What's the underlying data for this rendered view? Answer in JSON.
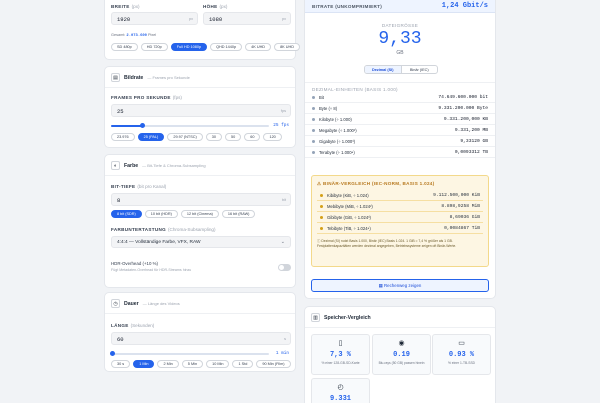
{
  "resolution": {
    "width_label": "BREITE",
    "width_unit": "(px)",
    "width_value": "1920",
    "width_suffix": "px",
    "height_label": "HÖHE",
    "height_unit": "(px)",
    "height_value": "1080",
    "height_suffix": "px",
    "total_prefix": "Gesamt:",
    "total_value": "2.073.600",
    "total_suffix": "Pixel",
    "presets": [
      "SD 480p",
      "HD 720p",
      "Full HD 1080p",
      "QHD 1440p",
      "4K UHD",
      "8K UHD"
    ],
    "active_preset": "Full HD 1080p"
  },
  "framerate": {
    "title": "Bildrate",
    "subtitle": "— Frames pro Sekunde",
    "label": "FRAMES PRO SEKUNDE",
    "unit": "(fps)",
    "value": "25",
    "suffix": "fps",
    "slider_readout": "25 fps",
    "slider_fraction": 0.2,
    "presets": [
      "23.976",
      "25 (PAL)",
      "29.97 (NTSC)",
      "30",
      "50",
      "60",
      "120"
    ],
    "active_preset": "25 (PAL)"
  },
  "color": {
    "title": "Farbe",
    "subtitle": "— Bit-Tiefe & Chroma-Subsampling",
    "bitdepth_label": "BIT-TIEFE",
    "bitdepth_unit": "(bit pro Kanal)",
    "bitdepth_value": "8",
    "bitdepth_suffix": "bit",
    "bitdepth_presets": [
      "8 bit (SDR)",
      "10 bit (HDR)",
      "12 bit (Cinema)",
      "16 bit (RAW)"
    ],
    "active_bitdepth": "8 bit (SDR)",
    "chroma_label": "FARBUNTERTASTUNG",
    "chroma_unit": "(Chroma-Subsampling)",
    "chroma_value": "4:4:4 — Vollständige Farbe, VFX, RAW",
    "hdr_label": "HDR-Overhead (+10 %)",
    "hdr_hint": "Fügt Metadaten-Overhead für HDR-Streams hinzu"
  },
  "duration": {
    "title": "Dauer",
    "subtitle": "— Länge des Videos",
    "label": "LÄNGE",
    "unit": "(Sekunden)",
    "value": "60",
    "suffix": "s",
    "slider_readout": "1 min",
    "slider_fraction": 0.01,
    "presets": [
      "30 s",
      "1 Min",
      "2 Min",
      "5 Min",
      "10 Min",
      "1 Std",
      "90 Min (Film)"
    ],
    "active_preset": "1 Min"
  },
  "result": {
    "bitrate_label": "BITRATE (UNKOMPRIMIERT)",
    "bitrate_value": "1,24 Gbit/s",
    "size_label": "DATEIGRÖSSE",
    "size_value": "9,33",
    "size_unit": "GB",
    "toggle_decimal": "Dezimal (SI)",
    "toggle_binary": "Binär (IEC)",
    "decimal_header": "DEZIMAL-EINHEITEN (BASIS 1.000)",
    "decimal_rows": [
      {
        "name": "Bit",
        "value": "74.649.600.000 bit"
      },
      {
        "name": "Byte (÷ 8)",
        "value": "9.331.200.000 Byte"
      },
      {
        "name": "Kilobyte (÷ 1.000)",
        "value": "9.331.200,000 KB"
      },
      {
        "name": "Megabyte (÷ 1.000²)",
        "value": "9.331,200 MB"
      },
      {
        "name": "Gigabyte (÷ 1.000³)",
        "value": "9,33120 GB"
      },
      {
        "name": "Terabyte (÷ 1.000⁴)",
        "value": "0,0093312 TB"
      }
    ],
    "binary_header": "BINÄR-VERGLEICH (IEC-NORM, BASIS 1.024)",
    "binary_rows": [
      {
        "name": "Kibibyte (KiB, ÷ 1.024)",
        "value": "9.112.500,000 KiB"
      },
      {
        "name": "Mebibyte (MiB, ÷ 1.024²)",
        "value": "8.898,9258 MiB"
      },
      {
        "name": "Gibibyte (GiB, ÷ 1.024³)",
        "value": "8,69036 GiB"
      },
      {
        "name": "Tebibyte (TiB, ÷ 1.024⁴)",
        "value": "0,0084867 TiB"
      }
    ],
    "binary_note": "Dezimal (SI) nutzt Basis 1.000, Binär (IEC) Basis 1.024. 1 GiB ≈ 7,4 % größer als 1 GB. Festplattenkapazitäten werden dezimal angegeben, Betriebssysteme zeigen oft Binär-Werte.",
    "calc_button": "Rechenweg zeigen"
  },
  "storage": {
    "title": "Speicher-Vergleich",
    "cards": [
      {
        "icon": "phone-icon",
        "glyph": "▯",
        "value": "7,3 %",
        "caption": "% einer 128-GB-SD-Karte"
      },
      {
        "icon": "disc-icon",
        "glyph": "◉",
        "value": "0.19",
        "caption": "Blu-rays (50 GB) passen hinein"
      },
      {
        "icon": "drive-icon",
        "glyph": "▭",
        "value": "0.93 %",
        "caption": "% einer 1-TB-SSD"
      },
      {
        "icon": "clock-icon",
        "glyph": "◴",
        "value": "9.331",
        "caption": ""
      }
    ]
  },
  "colors": {
    "accent": "#2563eb",
    "warn_bg": "#fdf6e3",
    "warn_border": "#f3d98b"
  }
}
